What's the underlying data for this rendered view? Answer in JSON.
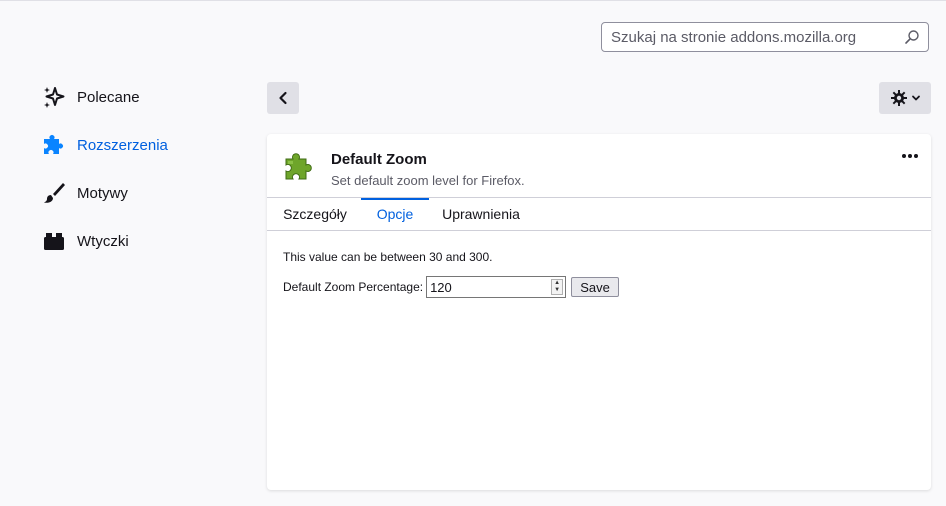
{
  "search": {
    "placeholder": "Szukaj na stronie addons.mozilla.org"
  },
  "sidebar": {
    "items": [
      {
        "label": "Polecane",
        "icon": "sparkle-icon",
        "active": false
      },
      {
        "label": "Rozszerzenia",
        "icon": "puzzle-icon",
        "active": true
      },
      {
        "label": "Motywy",
        "icon": "brush-icon",
        "active": false
      },
      {
        "label": "Wtyczki",
        "icon": "plugin-icon",
        "active": false
      }
    ]
  },
  "header": {
    "back_icon": "chevron-left-icon",
    "tools_icon": "gear-icon"
  },
  "addon": {
    "name": "Default Zoom",
    "description": "Set default zoom level for Firefox.",
    "more_icon": "more-dots-icon"
  },
  "tabs": [
    {
      "label": "Szczegóły",
      "active": false
    },
    {
      "label": "Opcje",
      "active": true
    },
    {
      "label": "Uprawnienia",
      "active": false
    }
  ],
  "options": {
    "note": "This value can be between 30 and 300.",
    "zoom_label": "Default Zoom Percentage:",
    "zoom_value": "120",
    "save_label": "Save"
  },
  "colors": {
    "accent": "#0060df",
    "background": "#f9f9fb",
    "button": "#e0e0e6"
  }
}
